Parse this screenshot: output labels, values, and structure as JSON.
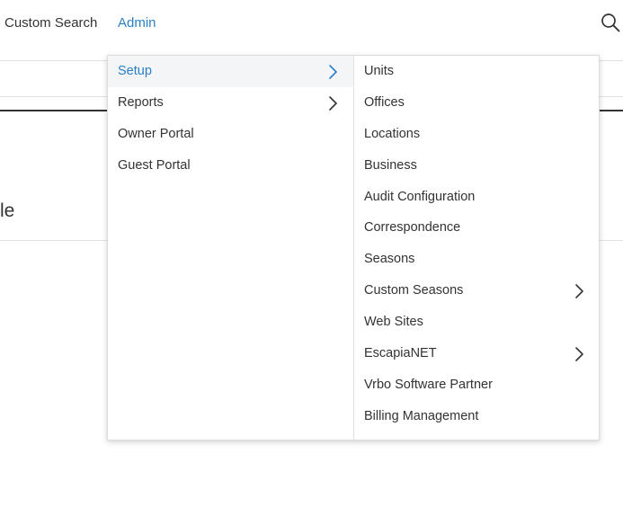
{
  "top_nav": {
    "items": [
      {
        "label": "Custom Search"
      },
      {
        "label": "Admin"
      }
    ],
    "search_icon": "search-icon",
    "accent_color": "#2a7fc6"
  },
  "page": {
    "heading_fragment": "le"
  },
  "admin_menu": {
    "primary": [
      {
        "label": "Setup",
        "has_submenu": true,
        "active": true
      },
      {
        "label": "Reports",
        "has_submenu": true
      },
      {
        "label": "Owner Portal",
        "has_submenu": false
      },
      {
        "label": "Guest Portal",
        "has_submenu": false
      }
    ],
    "setup_submenu": [
      {
        "label": "Units",
        "has_submenu": false
      },
      {
        "label": "Offices",
        "has_submenu": false
      },
      {
        "label": "Locations",
        "has_submenu": false
      },
      {
        "label": "Business",
        "has_submenu": false
      },
      {
        "label": "Audit Configuration",
        "has_submenu": false
      },
      {
        "label": "Correspondence",
        "has_submenu": false
      },
      {
        "label": "Seasons",
        "has_submenu": false
      },
      {
        "label": "Custom Seasons",
        "has_submenu": true
      },
      {
        "label": "Web Sites",
        "has_submenu": false
      },
      {
        "label": "EscapiaNET",
        "has_submenu": true
      },
      {
        "label": "Vrbo Software Partner",
        "has_submenu": false
      },
      {
        "label": "Billing Management",
        "has_submenu": false
      }
    ]
  }
}
